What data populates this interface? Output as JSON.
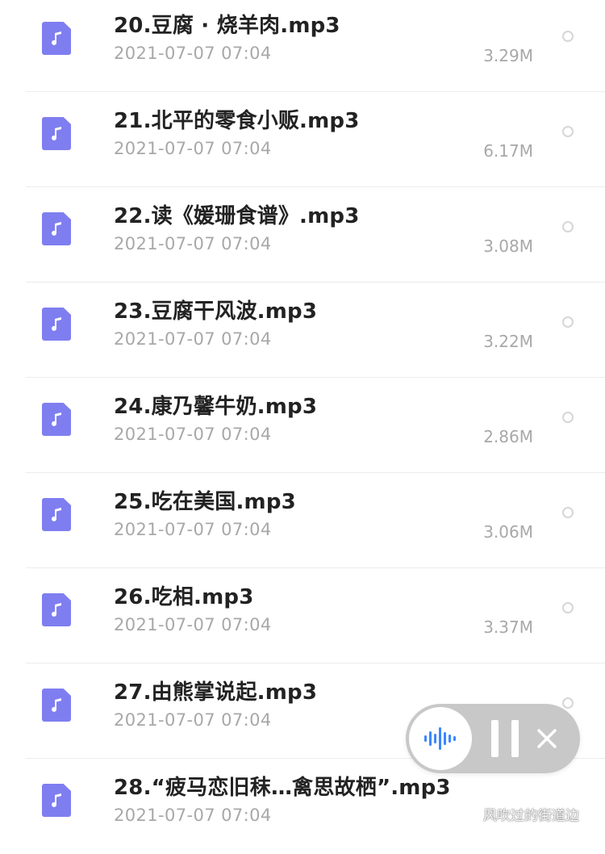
{
  "colors": {
    "file_icon": "#7f7ef0",
    "title_text": "#222222",
    "meta_text": "#a8a8a8",
    "player_bg": "#c8c8c8",
    "wave_accent": "#3a86ff"
  },
  "files": [
    {
      "name": "20.豆腐 · 烧羊肉.mp3",
      "date": "2021-07-07 07:04",
      "size": "3.29M",
      "icon": "music-file-icon",
      "selected": false
    },
    {
      "name": "21.北平的零食小贩.mp3",
      "date": "2021-07-07 07:04",
      "size": "6.17M",
      "icon": "music-file-icon",
      "selected": false
    },
    {
      "name": "22.读《媛珊食谱》.mp3",
      "date": "2021-07-07 07:04",
      "size": "3.08M",
      "icon": "music-file-icon",
      "selected": false
    },
    {
      "name": "23.豆腐干风波.mp3",
      "date": "2021-07-07 07:04",
      "size": "3.22M",
      "icon": "music-file-icon",
      "selected": false
    },
    {
      "name": "24.康乃馨牛奶.mp3",
      "date": "2021-07-07 07:04",
      "size": "2.86M",
      "icon": "music-file-icon",
      "selected": false
    },
    {
      "name": "25.吃在美国.mp3",
      "date": "2021-07-07 07:04",
      "size": "3.06M",
      "icon": "music-file-icon",
      "selected": false
    },
    {
      "name": "26.吃相.mp3",
      "date": "2021-07-07 07:04",
      "size": "3.37M",
      "icon": "music-file-icon",
      "selected": false
    },
    {
      "name": "27.由熊掌说起.mp3",
      "date": "2021-07-07 07:04",
      "size": "",
      "icon": "music-file-icon",
      "selected": false
    },
    {
      "name": "28.“疲马恋旧秣…禽思故栖”.mp3",
      "date": "2021-07-07 07:04",
      "size": "",
      "icon": "music-file-icon",
      "selected": false
    }
  ],
  "player": {
    "wave_icon": "sound-wave-icon",
    "pause_icon": "pause-icon",
    "close_icon": "close-icon"
  },
  "watermark": {
    "text": "风吹过的街道边",
    "icon": "wechat-logo-icon"
  }
}
